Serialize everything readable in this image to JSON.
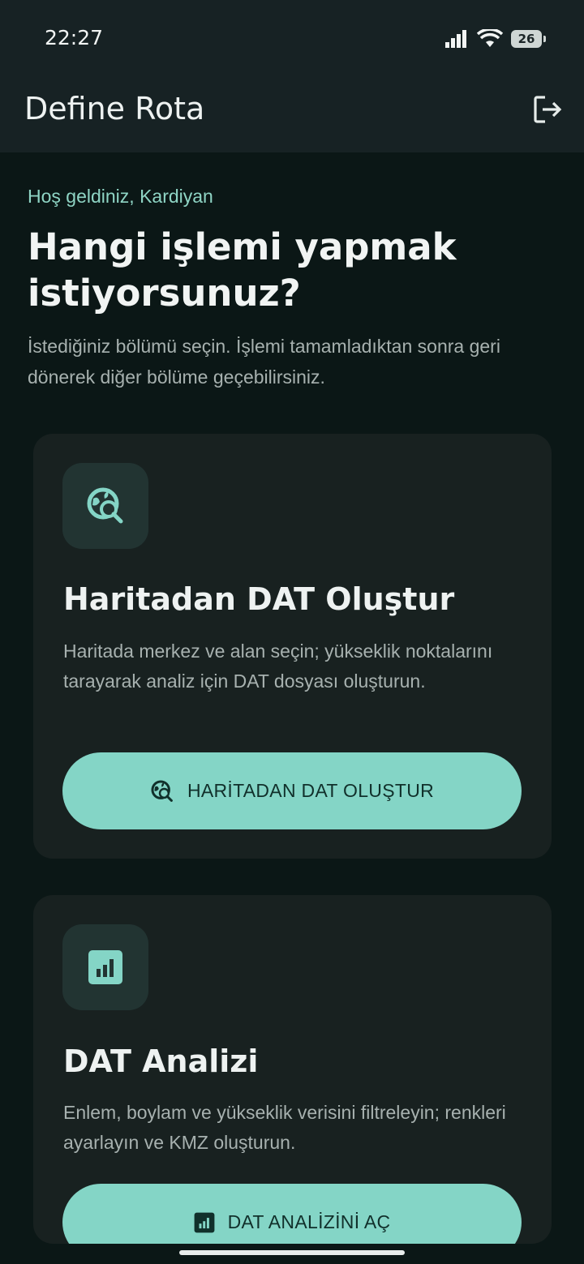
{
  "status_bar": {
    "time": "22:27",
    "battery": "26"
  },
  "app_bar": {
    "title": "Define Rota",
    "logout_icon": "logout-icon"
  },
  "welcome": "Hoş geldiniz, Kardiyan",
  "heading": "Hangi işlemi yapmak istiyorsunuz?",
  "subtitle": "İstediğiniz bölümü seçin. İşlemi tamamladıktan sonra geri dönerek diğer bölüme geçebilirsiniz.",
  "cards": [
    {
      "icon": "map-search-icon",
      "title": "Haritadan DAT Oluştur",
      "description": "Haritada merkez ve alan seçin; yükseklik noktalarını tarayarak analiz için DAT dosyası oluşturun.",
      "button_label": "HARİTADAN DAT OLUŞTUR"
    },
    {
      "icon": "analytics-icon",
      "title": "DAT Analizi",
      "description": "Enlem, boylam ve yükseklik verisini filtreleyin; renkleri ayarlayın ve KMZ oluşturun.",
      "button_label": "DAT ANALİZİNİ AÇ"
    }
  ],
  "colors": {
    "accent": "#84d5c6",
    "background": "#0b1716",
    "card": "#182120",
    "app_bar": "#172224"
  }
}
